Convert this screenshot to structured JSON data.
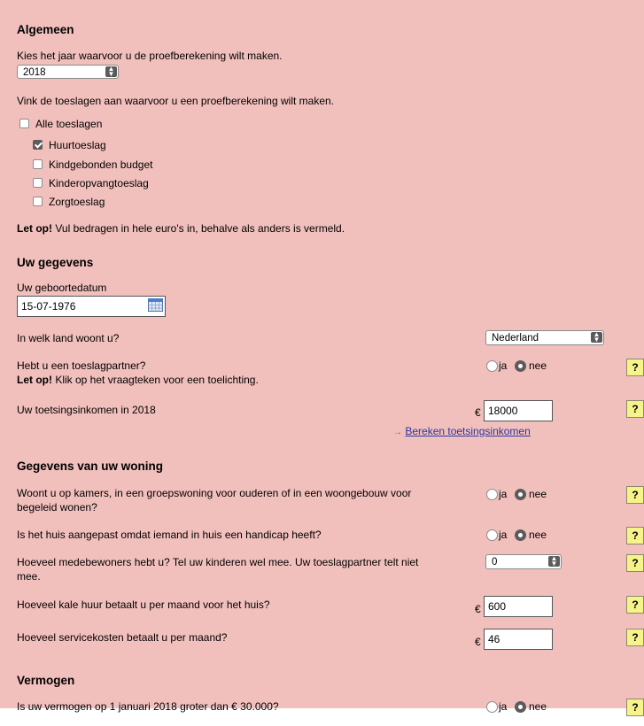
{
  "algemeen": {
    "heading": "Algemeen",
    "year_prompt": "Kies het jaar waarvoor u de proefberekening wilt maken.",
    "year_value": "2018",
    "toeslagen_prompt": "Vink de toeslagen aan waarvoor u een proefberekening wilt maken.",
    "all_label": "Alle toeslagen",
    "options": [
      {
        "label": "Huurtoeslag",
        "checked": true
      },
      {
        "label": "Kindgebonden budget",
        "checked": false
      },
      {
        "label": "Kinderopvangtoeslag",
        "checked": false
      },
      {
        "label": "Zorgtoeslag",
        "checked": false
      }
    ],
    "note_bold": "Let op!",
    "note_text": " Vul bedragen in hele euro's in, behalve als anders is vermeld."
  },
  "gegevens": {
    "heading": "Uw gegevens",
    "birth_label": "Uw geboortedatum",
    "birth_value": "15-07-1976",
    "country_question": "In welk land woont u?",
    "country_value": "Nederland",
    "partner_question": "Hebt u een toeslagpartner?",
    "partner_note_bold": "Let op!",
    "partner_note_text": " Klik op het vraagteken voor een toelichting.",
    "income_question": "Uw toetsingsinkomen in 2018",
    "income_value": "18000",
    "income_link": "Bereken toetsingsinkomen",
    "link_arrow": "→"
  },
  "woning": {
    "heading": "Gegevens van uw woning",
    "q_kamers_1": "Woont u op kamers, in een groepswoning voor ouderen of in een woongebouw voor",
    "q_kamers_2": "begeleid wonen?",
    "q_handicap": "Is het huis aangepast omdat iemand in huis een handicap heeft?",
    "q_medebewoners_1": "Hoeveel medebewoners hebt u? Tel uw kinderen wel mee. Uw toeslagpartner telt niet",
    "q_medebewoners_2": "mee.",
    "medebewoners_value": "0",
    "q_huur": "Hoeveel kale huur betaalt u per maand voor het huis?",
    "huur_value": "600",
    "q_service": "Hoeveel servicekosten betaalt u per maand?",
    "service_value": "46"
  },
  "vermogen": {
    "heading": "Vermogen",
    "question": "Is uw vermogen op 1 januari 2018 groter dan € 30.000?"
  },
  "common": {
    "ja": "ja",
    "nee": "nee",
    "euro": "€",
    "help": "?",
    "sel_up": "▲",
    "sel_down": "▼"
  },
  "colors": {
    "panel_bg": "#f2c0bc",
    "help_bg": "#f6f38a",
    "link": "#2a36a0"
  },
  "icons": [
    "calendar-icon",
    "select-arrows-icon",
    "checkbox",
    "radio",
    "help-icon"
  ]
}
